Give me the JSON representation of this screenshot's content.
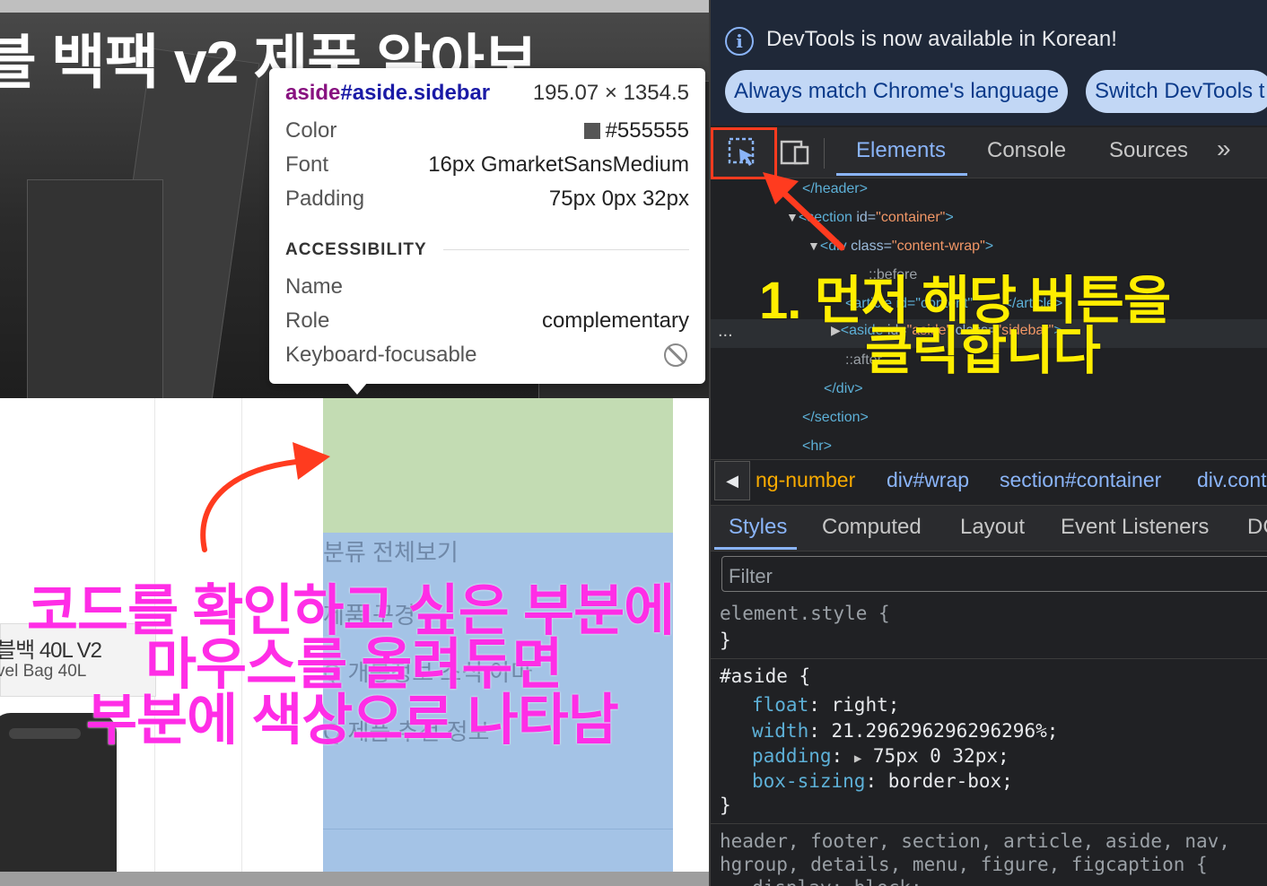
{
  "page": {
    "hero_title": "블 백팩 v2 제품 알아보",
    "aside_items": [
      "분류 전체보기",
      "제품 구경",
      "Q 개봉정보 소식 아마",
      "Q 제품 추천 정보"
    ],
    "product_name": "블백 40L V2",
    "product_sub": "vel Bag 40L"
  },
  "tooltip": {
    "selector_tag": "aside",
    "selector_rest": "#aside.sidebar",
    "dimensions": "195.07 × 1354.5",
    "rows": {
      "color_label": "Color",
      "color_value": "#555555",
      "font_label": "Font",
      "font_value": "16px GmarketSansMedium",
      "padding_label": "Padding",
      "padding_value": "75px 0px 32px"
    },
    "accessibility_heading": "ACCESSIBILITY",
    "acc_rows": {
      "name_label": "Name",
      "name_value": "",
      "role_label": "Role",
      "role_value": "complementary",
      "focus_label": "Keyboard-focusable"
    },
    "swatch_color": "#555555"
  },
  "annotations": {
    "pink_line1": "코드를 확인하고 싶은 부분에",
    "pink_line2": "마우스를 올려두면",
    "pink_line3": "부분에 색상으로 나타남",
    "yellow_line1": "1. 먼저 해당 버튼을",
    "yellow_line2": "클릭합니다",
    "pink_color": "#ff2de6",
    "yellow_color": "#ffee00",
    "arrow_color": "#ff3b1f"
  },
  "devtools": {
    "info_message": "DevTools is now available in Korean!",
    "btn_match_language": "Always match Chrome's language",
    "btn_switch": "Switch DevTools t",
    "tabs": [
      "Elements",
      "Console",
      "Sources"
    ],
    "more_tabs": "»",
    "dom": {
      "l1": "</header>",
      "l2_tag": "<section ",
      "l2_attr": "id=",
      "l2_val": "\"container\"",
      "l2_end": ">",
      "l3_tag": "<div ",
      "l3_attr": "class=",
      "l3_val": "\"content-wrap\"",
      "l3_end": ">",
      "l4": "::before",
      "l5_a": "<article id=\"content\"",
      "l5_b": "</article>",
      "l6_tag": "<aside ",
      "l6_attr1": "id=",
      "l6_val1": "\"aside\"",
      "l6_attr2": " class=",
      "l6_val2": "\"sidebar\"",
      "l6_end": ">",
      "l7": "::after",
      "l8": "</div>",
      "l9": "</section>",
      "l10": "<hr>",
      "dots": "..."
    },
    "breadcrumbs": [
      "ng-number",
      "div#wrap",
      "section#container",
      "div.cont"
    ],
    "styles_tabs": [
      "Styles",
      "Computed",
      "Layout",
      "Event Listeners",
      "DC"
    ],
    "filter_placeholder": "Filter",
    "css": {
      "element_style": "element.style {",
      "close1": "}",
      "aside_sel": "#aside {",
      "p1": "float",
      "v1": "right;",
      "p2": "width",
      "v2": "21.296296296296296%;",
      "p3": "padding",
      "v3": "75px 0 32px;",
      "p4": "box-sizing",
      "v4": "border-box;",
      "close2": "}",
      "ua_line1": "header, footer, section, article, aside, nav,",
      "ua_line2": "hgroup, details, menu, figure, figcaption {",
      "ua_line3": "display: block;"
    }
  }
}
